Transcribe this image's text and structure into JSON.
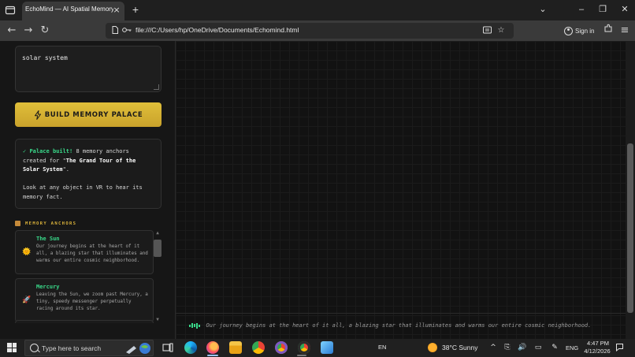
{
  "browser": {
    "tab_title": "EchoMind — AI Spatial Memory Pa",
    "tab_close": "×",
    "new_tab": "+",
    "url": "file:///C:/Users/hp/OneDrive/Documents/Echomind.html",
    "sign_in": "Sign in"
  },
  "sidebar": {
    "topic_value": "solar system",
    "build_button_label": "BUILD MEMORY PALACE",
    "status": {
      "check": "✓",
      "built_text": "Palace built!",
      "created_prefix": " 8 memory anchors created for \"",
      "palace_title": "The Grand Tour of the Solar System",
      "created_suffix": "\".",
      "hint": "Look at any object in VR to hear its memory fact."
    },
    "anchors_label": "MEMORY ANCHORS",
    "anchors": [
      {
        "emoji": "🌞",
        "name": "The Sun",
        "text": "Our journey begins at the heart of it all, a blazing star that illuminates and warms our entire cosmic neighborhood."
      },
      {
        "emoji": "🚀",
        "name": "Mercury",
        "text": "Leaving the Sun, we zoom past Mercury, a tiny, speedy messenger perpetually racing around its star."
      }
    ]
  },
  "caption": {
    "text": "Our journey begins at the heart of it all, a blazing star that illuminates and warms our entire cosmic neighborhood."
  },
  "taskbar": {
    "search_placeholder": "Type here to search",
    "language": "EN",
    "weather": "38°C  Sunny",
    "input_lang": "ENG",
    "time": "4:47 PM",
    "date": "4/12/2026"
  },
  "colors": {
    "accent_gold": "#d9b43a",
    "accent_green": "#39d98a",
    "background": "#121212"
  }
}
